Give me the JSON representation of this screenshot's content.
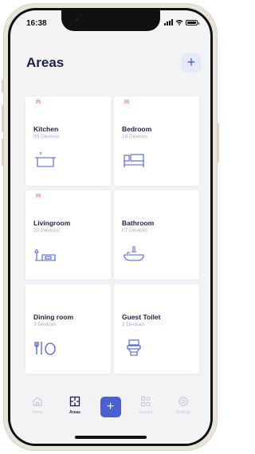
{
  "status_bar": {
    "time": "16:38"
  },
  "header": {
    "title": "Areas",
    "add_label": "+"
  },
  "areas": [
    {
      "name": "Kitchen",
      "devices": "05 Devices",
      "icon": "pot-icon",
      "pinned": true
    },
    {
      "name": "Bedroom",
      "devices": "10 Devices",
      "icon": "bed-icon",
      "pinned": true
    },
    {
      "name": "Livingroom",
      "devices": "10 Devices",
      "icon": "sofa-lamp-icon",
      "pinned": true
    },
    {
      "name": "Bathroom",
      "devices": "07 Devices",
      "icon": "bathtub-icon",
      "pinned": false
    },
    {
      "name": "Dining room",
      "devices": "3 Devices",
      "icon": "cutlery-plate-icon",
      "pinned": false
    },
    {
      "name": "Guest Toilet",
      "devices": "2 Devices",
      "icon": "toilet-icon",
      "pinned": false
    }
  ],
  "tabbar": {
    "tabs": [
      {
        "label": "Home",
        "icon": "home-icon",
        "active": false
      },
      {
        "label": "Areas",
        "icon": "floorplan-icon",
        "active": true
      },
      {
        "label": "Scenes",
        "icon": "scenes-icon",
        "active": false
      },
      {
        "label": "Settings",
        "icon": "gear-icon",
        "active": false
      }
    ],
    "add_label": "+"
  },
  "colors": {
    "accent": "#4a62cf",
    "text": "#1e2146",
    "muted": "#a9abbf",
    "pin": "#f1b8c2"
  }
}
